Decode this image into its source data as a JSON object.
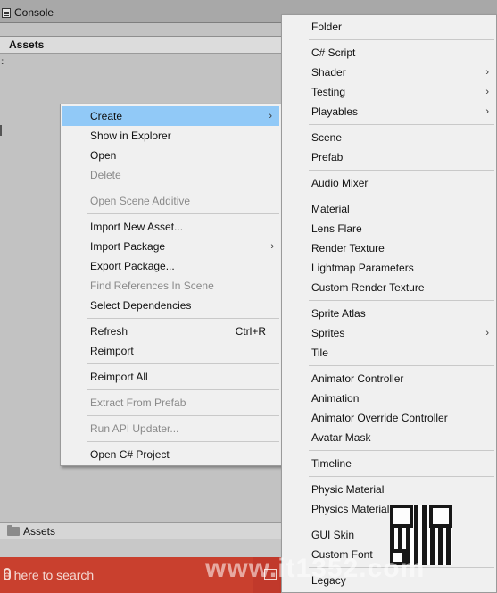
{
  "console_tab": {
    "label": "Console"
  },
  "project_panel": {
    "header": "Assets",
    "dots": "::",
    "breadcrumb": "Assets"
  },
  "taskbar": {
    "search_placeholder": "e here to search"
  },
  "watermark": {
    "text": "www.it1352.com"
  },
  "context_menu": {
    "items": [
      {
        "label": "Create",
        "arrow": "›",
        "highlighted": true
      },
      {
        "label": "Show in Explorer"
      },
      {
        "label": "Open"
      },
      {
        "label": "Delete",
        "disabled": true
      },
      {
        "sep": true
      },
      {
        "label": "Open Scene Additive",
        "disabled": true
      },
      {
        "sep": true
      },
      {
        "label": "Import New Asset..."
      },
      {
        "label": "Import Package",
        "arrow": "›"
      },
      {
        "label": "Export Package..."
      },
      {
        "label": "Find References In Scene",
        "disabled": true
      },
      {
        "label": "Select Dependencies"
      },
      {
        "sep": true
      },
      {
        "label": "Refresh",
        "shortcut": "Ctrl+R"
      },
      {
        "label": "Reimport"
      },
      {
        "sep": true
      },
      {
        "label": "Reimport All"
      },
      {
        "sep": true
      },
      {
        "label": "Extract From Prefab",
        "disabled": true
      },
      {
        "sep": true
      },
      {
        "label": "Run API Updater...",
        "disabled": true
      },
      {
        "sep": true
      },
      {
        "label": "Open C# Project"
      }
    ]
  },
  "create_submenu": {
    "items": [
      {
        "label": "Folder"
      },
      {
        "sep": true
      },
      {
        "label": "C# Script"
      },
      {
        "label": "Shader",
        "arrow": "›"
      },
      {
        "label": "Testing",
        "arrow": "›"
      },
      {
        "label": "Playables",
        "arrow": "›"
      },
      {
        "sep": true
      },
      {
        "label": "Scene"
      },
      {
        "label": "Prefab"
      },
      {
        "sep": true
      },
      {
        "label": "Audio Mixer"
      },
      {
        "sep": true
      },
      {
        "label": "Material"
      },
      {
        "label": "Lens Flare"
      },
      {
        "label": "Render Texture"
      },
      {
        "label": "Lightmap Parameters"
      },
      {
        "label": "Custom Render Texture"
      },
      {
        "sep": true
      },
      {
        "label": "Sprite Atlas"
      },
      {
        "label": "Sprites",
        "arrow": "›"
      },
      {
        "label": "Tile"
      },
      {
        "sep": true
      },
      {
        "label": "Animator Controller"
      },
      {
        "label": "Animation"
      },
      {
        "label": "Animator Override Controller"
      },
      {
        "label": "Avatar Mask"
      },
      {
        "sep": true
      },
      {
        "label": "Timeline"
      },
      {
        "sep": true
      },
      {
        "label": "Physic Material"
      },
      {
        "label": "Physics Material"
      },
      {
        "sep": true
      },
      {
        "label": "GUI Skin"
      },
      {
        "label": "Custom Font"
      },
      {
        "sep": true
      },
      {
        "label": "Legacy"
      }
    ]
  },
  "colors": {
    "highlight": "#91c9f7",
    "menu_bg": "#f0f0f0",
    "taskbar": "#c1392b"
  }
}
